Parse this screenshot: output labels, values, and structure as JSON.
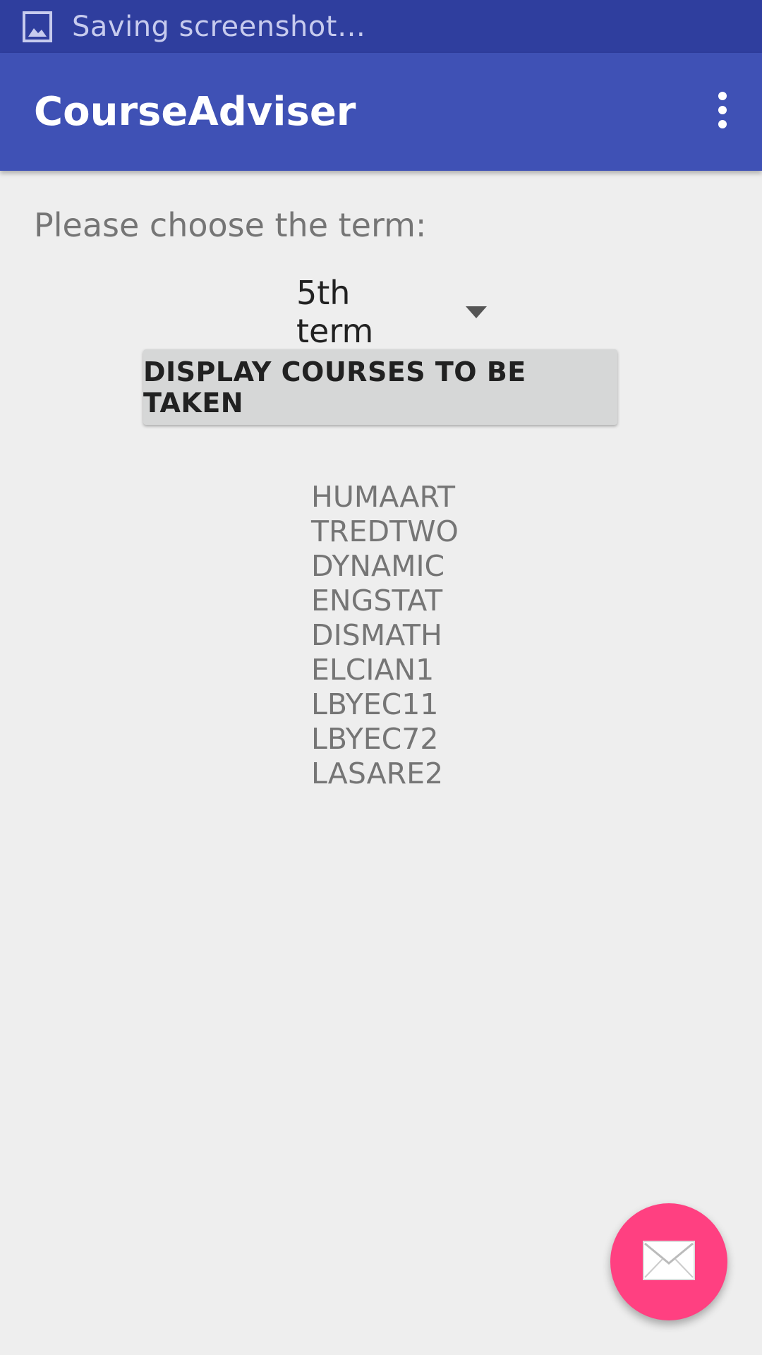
{
  "status_bar": {
    "notification_icon": "image-icon",
    "text": "Saving screenshot…"
  },
  "app_bar": {
    "title": "CourseAdviser",
    "overflow_icon": "more-vert-icon"
  },
  "main": {
    "prompt": "Please choose the term:",
    "term_spinner": {
      "selected": "5th term",
      "icon": "dropdown-arrow-icon"
    },
    "display_button_label": "DISPLAY COURSES TO BE TAKEN",
    "courses": [
      "HUMAART",
      "TREDTWO",
      "DYNAMIC",
      "ENGSTAT",
      "DISMATH",
      "ELCIAN1",
      "LBYEC11",
      "LBYEC72",
      "LASARE2"
    ]
  },
  "fab": {
    "icon": "email-icon"
  },
  "colors": {
    "status_bar": "#2f3e9e",
    "app_bar": "#3f51b5",
    "background": "#eeeeee",
    "button": "#d6d7d7",
    "fab": "#ff4081"
  }
}
